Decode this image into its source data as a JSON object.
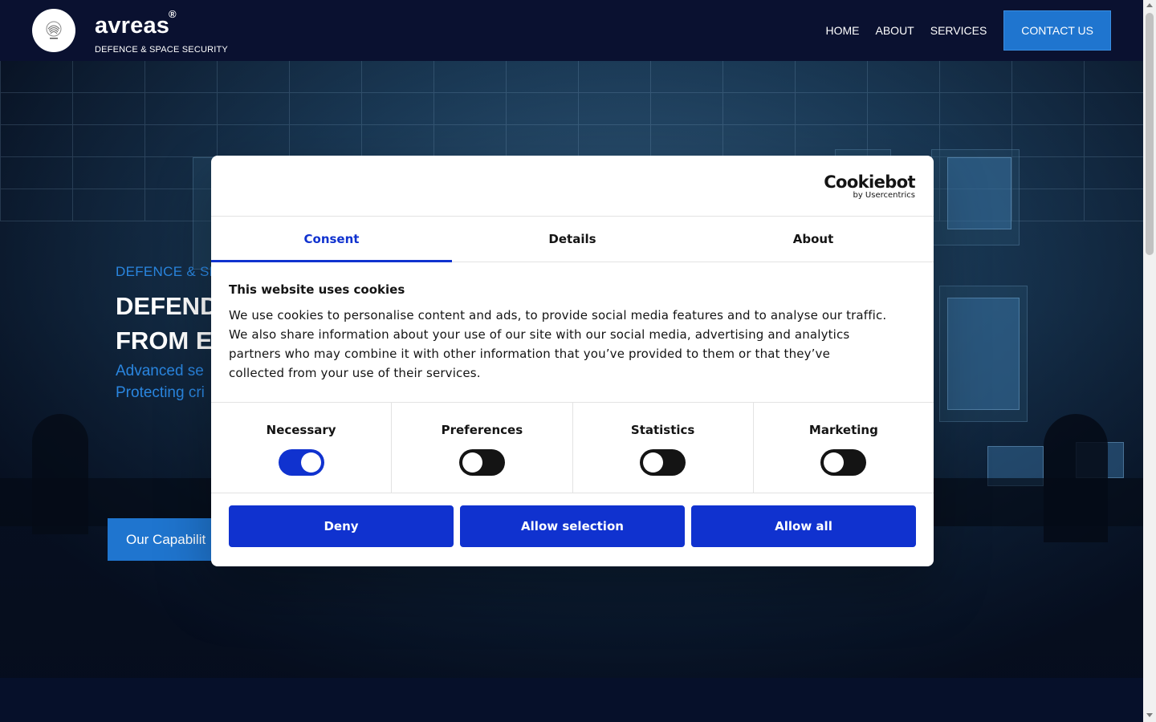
{
  "header": {
    "brand": "avreas",
    "registered_mark": "®",
    "tagline": "DEFENCE & SPACE SECURITY",
    "nav": [
      {
        "label": "HOME"
      },
      {
        "label": "ABOUT"
      },
      {
        "label": "SERVICES"
      }
    ],
    "contact_label": "CONTACT US"
  },
  "hero": {
    "overline": "DEFENCE & SP",
    "title_line1": "DEFENDI",
    "title_line2": "FROM EA",
    "subtitle_line1": "Advanced se",
    "subtitle_line2": "Protecting cri",
    "cta_label": "Our Capabilit"
  },
  "cookie_dialog": {
    "logo_main": "Cookiebot",
    "logo_by": "by Usercentrics",
    "tabs": [
      {
        "label": "Consent",
        "active": true
      },
      {
        "label": "Details",
        "active": false
      },
      {
        "label": "About",
        "active": false
      }
    ],
    "heading": "This website uses cookies",
    "body": "We use cookies to personalise content and ads, to provide social media features and to analyse our traffic. We also share information about your use of our site with our social media, advertising and analytics partners who may combine it with other information that you’ve provided to them or that they’ve collected from your use of their services.",
    "categories": [
      {
        "label": "Necessary",
        "enabled": true
      },
      {
        "label": "Preferences",
        "enabled": false
      },
      {
        "label": "Statistics",
        "enabled": false
      },
      {
        "label": "Marketing",
        "enabled": false
      }
    ],
    "buttons": {
      "deny": "Deny",
      "allow_selection": "Allow selection",
      "allow_all": "Allow all"
    },
    "accent_color": "#1032cf"
  },
  "colors": {
    "header_bg": "#0a1130",
    "brand_blue": "#1f75cf",
    "hero_accent": "#2a86e0"
  }
}
